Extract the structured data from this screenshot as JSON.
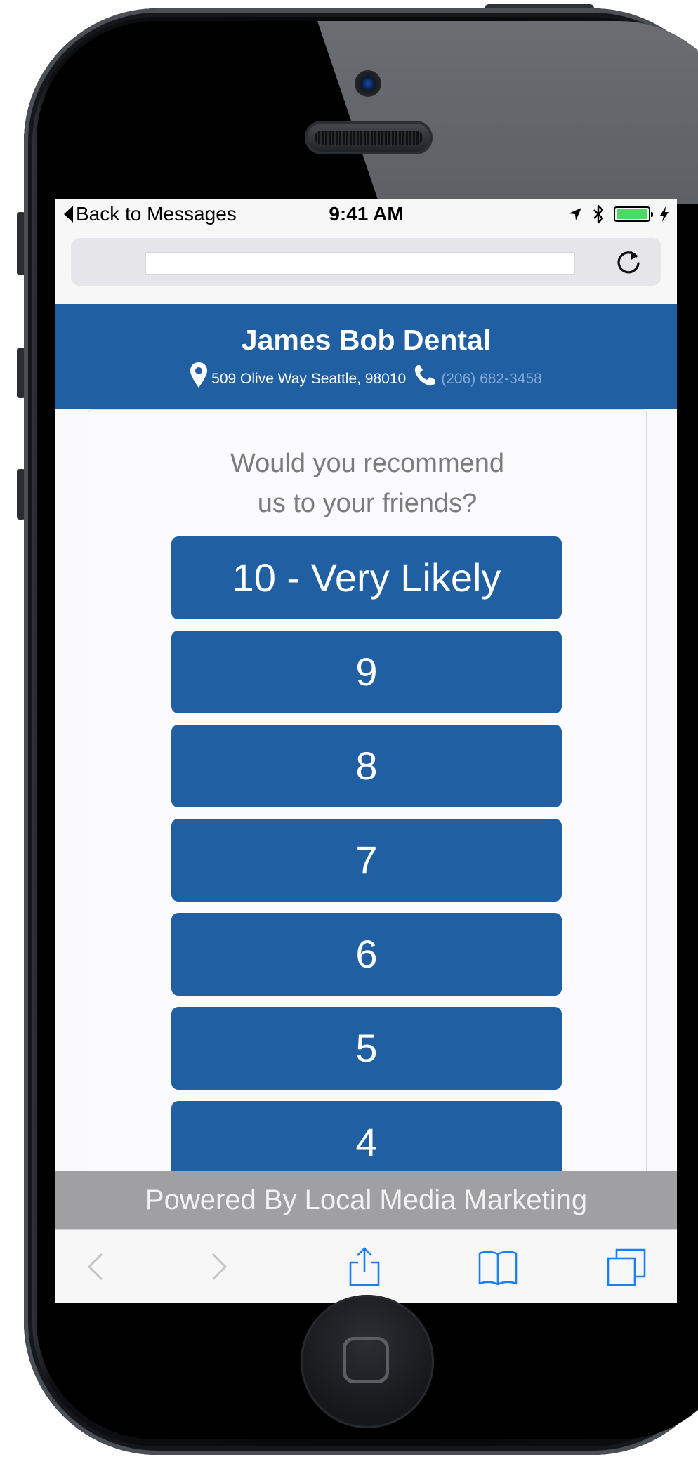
{
  "status_bar": {
    "back_label": "Back to Messages",
    "time": "9:41 AM",
    "icons": [
      "location-arrow-icon",
      "bluetooth-icon",
      "battery-icon",
      "charging-bolt-icon"
    ],
    "battery_level": 1.0,
    "battery_color": "#4cd964"
  },
  "browser": {
    "url": "",
    "reload_icon": "reload-icon"
  },
  "header": {
    "business_name": "James Bob Dental",
    "address": "509 Olive Way Seattle, 98010",
    "phone": "(206) 682-3458",
    "background_color": "#1f5fa2"
  },
  "survey": {
    "question_line1": "Would you recommend",
    "question_line2": "us to your friends?",
    "options": [
      "10 - Very Likely",
      "9",
      "8",
      "7",
      "6",
      "5",
      "4"
    ]
  },
  "footer": {
    "powered_by": "Powered By Local Media Marketing"
  },
  "toolbar": {
    "icons": [
      "back-arrow-icon",
      "forward-arrow-icon",
      "share-icon",
      "bookmarks-icon",
      "tabs-icon"
    ]
  }
}
